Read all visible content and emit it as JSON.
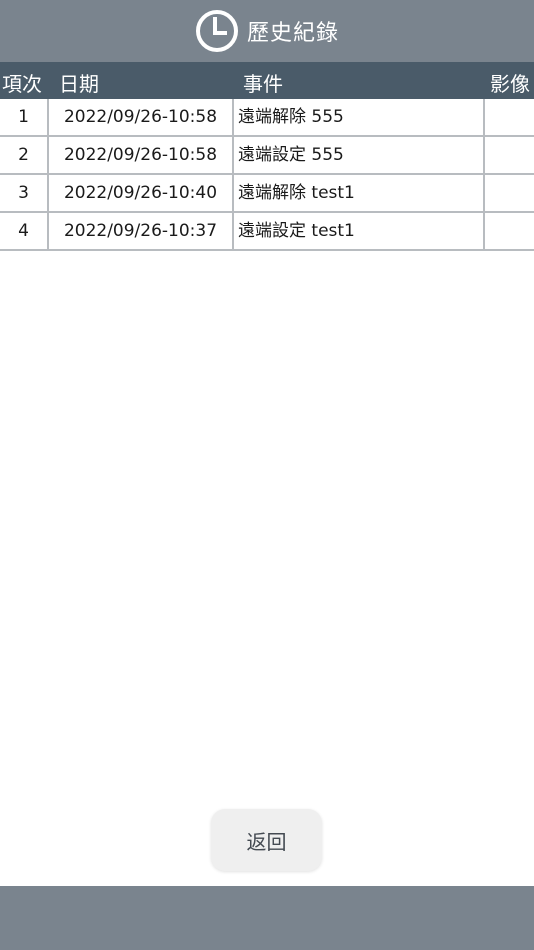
{
  "header": {
    "title": "歷史紀錄",
    "icon": "clock-icon"
  },
  "columns": {
    "no": "項次",
    "date": "日期",
    "event": "事件",
    "image": "影像"
  },
  "rows": [
    {
      "no": "1",
      "date": "2022/09/26-10:58",
      "event": "遠端解除 555",
      "image": ""
    },
    {
      "no": "2",
      "date": "2022/09/26-10:58",
      "event": "遠端設定 555",
      "image": ""
    },
    {
      "no": "3",
      "date": "2022/09/26-10:40",
      "event": "遠端解除 test1",
      "image": ""
    },
    {
      "no": "4",
      "date": "2022/09/26-10:37",
      "event": "遠端設定 test1",
      "image": ""
    }
  ],
  "back_button": {
    "label": "返回"
  },
  "colors": {
    "header_bg": "#7a848e",
    "column_header_bg": "#4a5b69",
    "grid_line": "#b8bcc0"
  }
}
